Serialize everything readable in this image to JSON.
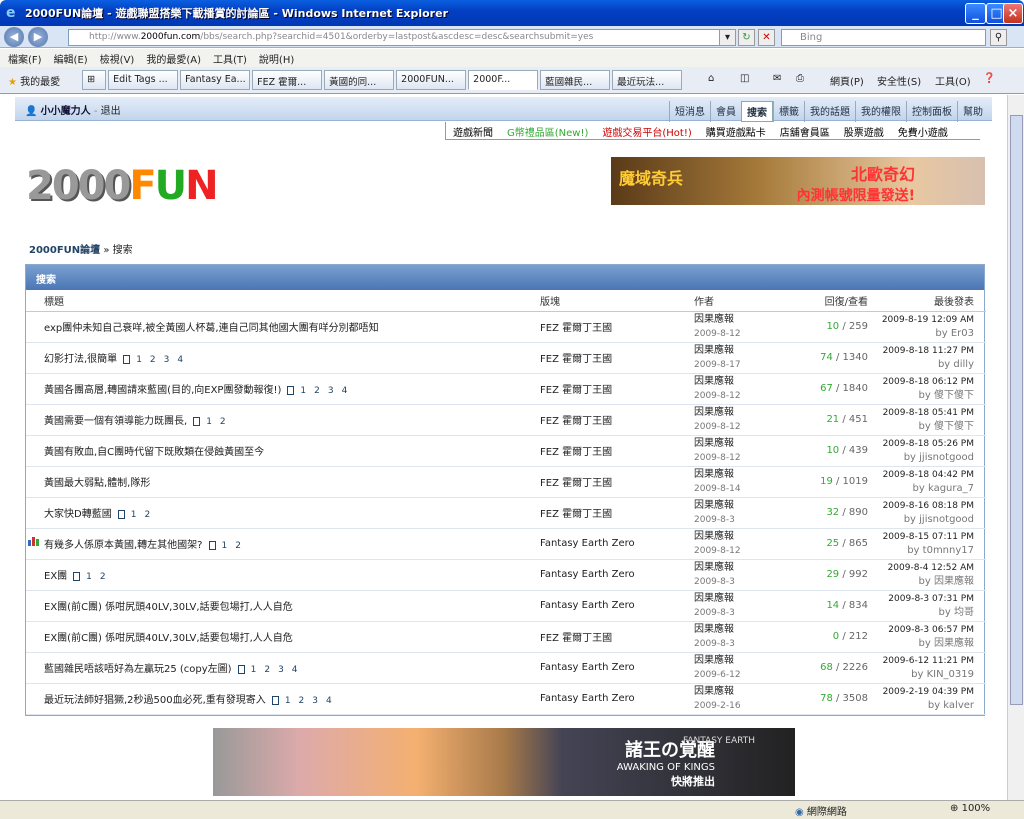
{
  "window": {
    "title": "2000FUN論壇 - 遊戲聯盟搭樂下載播賞的討論區 - Windows Internet Explorer"
  },
  "address": {
    "url_prefix": "http://www.",
    "url_host": "2000fun.com",
    "url_rest": "/bbs/search.php?searchid=4501&orderby=lastpost&ascdesc=desc&searchsubmit=yes",
    "search_placeholder": "Bing"
  },
  "menu": [
    "檔案(F)",
    "編輯(E)",
    "檢視(V)",
    "我的最愛(A)",
    "工具(T)",
    "說明(H)"
  ],
  "favorites": {
    "label": "我的最愛"
  },
  "tabs": [
    {
      "label": "Edit Tags ..."
    },
    {
      "label": "Fantasy Ea..."
    },
    {
      "label": "FEZ 霍爾..."
    },
    {
      "label": "黃國的同..."
    },
    {
      "label": "2000FUN..."
    },
    {
      "label": "2000F...",
      "active": true
    },
    {
      "label": "藍國雜民..."
    },
    {
      "label": "最近玩法..."
    }
  ],
  "toolbar_right": {
    "page": "網頁(P)",
    "safety": "安全性(S)",
    "tools": "工具(O)"
  },
  "site": {
    "user": "小小魔力人",
    "logout": "退出",
    "nav": [
      "短消息",
      "會員",
      "搜索",
      "標籤",
      "我的話題",
      "我的權限",
      "控制面板",
      "幫助"
    ],
    "nav_active": 2,
    "games": [
      {
        "label": "遊戲新聞",
        "style": ""
      },
      {
        "label": "G幣禮品區(New!)",
        "style": "g"
      },
      {
        "label": "遊戲交易平台(Hot!)",
        "style": "r"
      },
      {
        "label": "購買遊戲點卡",
        "style": ""
      },
      {
        "label": "店舖會員區",
        "style": ""
      },
      {
        "label": "股票遊戲",
        "style": ""
      },
      {
        "label": "免費小遊戲",
        "style": ""
      }
    ],
    "logo": {
      "a": "2000",
      "f": "F",
      "u": "U",
      "n": "N"
    },
    "banner": {
      "left": "魔域奇兵",
      "main": "北歐奇幻",
      "sub": "內測帳號限量發送!"
    },
    "breadcrumb": {
      "home": "2000FUN論壇",
      "sep": " » ",
      "current": "搜索"
    }
  },
  "panel": {
    "title": "搜索",
    "headers": {
      "title": "標題",
      "board": "版塊",
      "author": "作者",
      "stats": "回復/查看",
      "last": "最後發表"
    },
    "rows": [
      {
        "title": "exp團仲未知自己衰咩,被全黃國人杯葛,連自己同其他國大團有咩分別都唔知",
        "pages": [],
        "board": "FEZ 霍爾丁王國",
        "author": "因果應報",
        "date": "2009-8-12",
        "replies": "10",
        "views": "259",
        "last_time": "2009-8-19 12:09 AM",
        "last_by": "Er03"
      },
      {
        "title": "幻影打法,很簡單",
        "pages": [
          "1",
          "2",
          "3",
          "4"
        ],
        "board": "FEZ 霍爾丁王國",
        "author": "因果應報",
        "date": "2009-8-17",
        "replies": "74",
        "views": "1340",
        "last_time": "2009-8-18 11:27 PM",
        "last_by": "dilly"
      },
      {
        "title": "黃國各團高層,轉國請來藍國(目的,向EXP團發動報復!)",
        "pages": [
          "1",
          "2",
          "3",
          "4"
        ],
        "board": "FEZ 霍爾丁王國",
        "author": "因果應報",
        "date": "2009-8-12",
        "replies": "67",
        "views": "1840",
        "last_time": "2009-8-18 06:12 PM",
        "last_by": "傻下傻下"
      },
      {
        "title": "黃國需要一個有領導能力既團長,",
        "pages": [
          "1",
          "2"
        ],
        "board": "FEZ 霍爾丁王國",
        "author": "因果應報",
        "date": "2009-8-12",
        "replies": "21",
        "views": "451",
        "last_time": "2009-8-18 05:41 PM",
        "last_by": "傻下傻下"
      },
      {
        "title": "黃國有敗血,自C團時代留下既敗類在侵蝕黃國至今",
        "pages": [],
        "board": "FEZ 霍爾丁王國",
        "author": "因果應報",
        "date": "2009-8-12",
        "replies": "10",
        "views": "439",
        "last_time": "2009-8-18 05:26 PM",
        "last_by": "jjisnotgood"
      },
      {
        "title": "黃國最大弱點,體制,隊形",
        "pages": [],
        "board": "FEZ 霍爾丁王國",
        "author": "因果應報",
        "date": "2009-8-14",
        "replies": "19",
        "views": "1019",
        "last_time": "2009-8-18 04:42 PM",
        "last_by": "kagura_7"
      },
      {
        "title": "大家快D轉藍國",
        "pages": [
          "1",
          "2"
        ],
        "board": "FEZ 霍爾丁王國",
        "author": "因果應報",
        "date": "2009-8-3",
        "replies": "32",
        "views": "890",
        "last_time": "2009-8-16 08:18 PM",
        "last_by": "jjisnotgood"
      },
      {
        "title": "有幾多人係原本黃國,轉左其他國架?",
        "pages": [
          "1",
          "2"
        ],
        "board": "Fantasy Earth Zero",
        "author": "因果應報",
        "date": "2009-8-12",
        "replies": "25",
        "views": "865",
        "last_time": "2009-8-15 07:11 PM",
        "last_by": "t0mnny17",
        "poll": true
      },
      {
        "title": "EX團",
        "pages": [
          "1",
          "2"
        ],
        "board": "Fantasy Earth Zero",
        "author": "因果應報",
        "date": "2009-8-3",
        "replies": "29",
        "views": "992",
        "last_time": "2009-8-4 12:52 AM",
        "last_by": "因果應報"
      },
      {
        "title": "EX團(前C團) 係咁尻頭40LV,30LV,話要包場打,人人自危",
        "pages": [],
        "board": "Fantasy Earth Zero",
        "author": "因果應報",
        "date": "2009-8-3",
        "replies": "14",
        "views": "834",
        "last_time": "2009-8-3 07:31 PM",
        "last_by": "均哥"
      },
      {
        "title": "EX團(前C團) 係咁尻頭40LV,30LV,話要包場打,人人自危",
        "pages": [],
        "board": "FEZ 霍爾丁王國",
        "author": "因果應報",
        "date": "2009-8-3",
        "replies": "0",
        "views": "212",
        "last_time": "2009-8-3 06:57 PM",
        "last_by": "因果應報"
      },
      {
        "title": "藍國雜民唔該唔好為左贏玩25 (copy左圖)",
        "pages": [
          "1",
          "2",
          "3",
          "4"
        ],
        "board": "Fantasy Earth Zero",
        "author": "因果應報",
        "date": "2009-6-12",
        "replies": "68",
        "views": "2226",
        "last_time": "2009-6-12 11:21 PM",
        "last_by": "KIN_0319"
      },
      {
        "title": "最近玩法師好猖獗,2秒過500血必死,重有發現寄入",
        "pages": [
          "1",
          "2",
          "3",
          "4"
        ],
        "board": "Fantasy Earth Zero",
        "author": "因果應報",
        "date": "2009-2-16",
        "replies": "78",
        "views": "3508",
        "last_time": "2009-2-19 04:39 PM",
        "last_by": "kalver"
      }
    ]
  },
  "bottom_banner": {
    "kanji": "諸王の覚醒",
    "english": "AWAKING OF KINGS",
    "coming": "快將推出",
    "brand": "FANTASY EARTH"
  },
  "status": {
    "network": "網際網路",
    "zoom": "100%"
  }
}
